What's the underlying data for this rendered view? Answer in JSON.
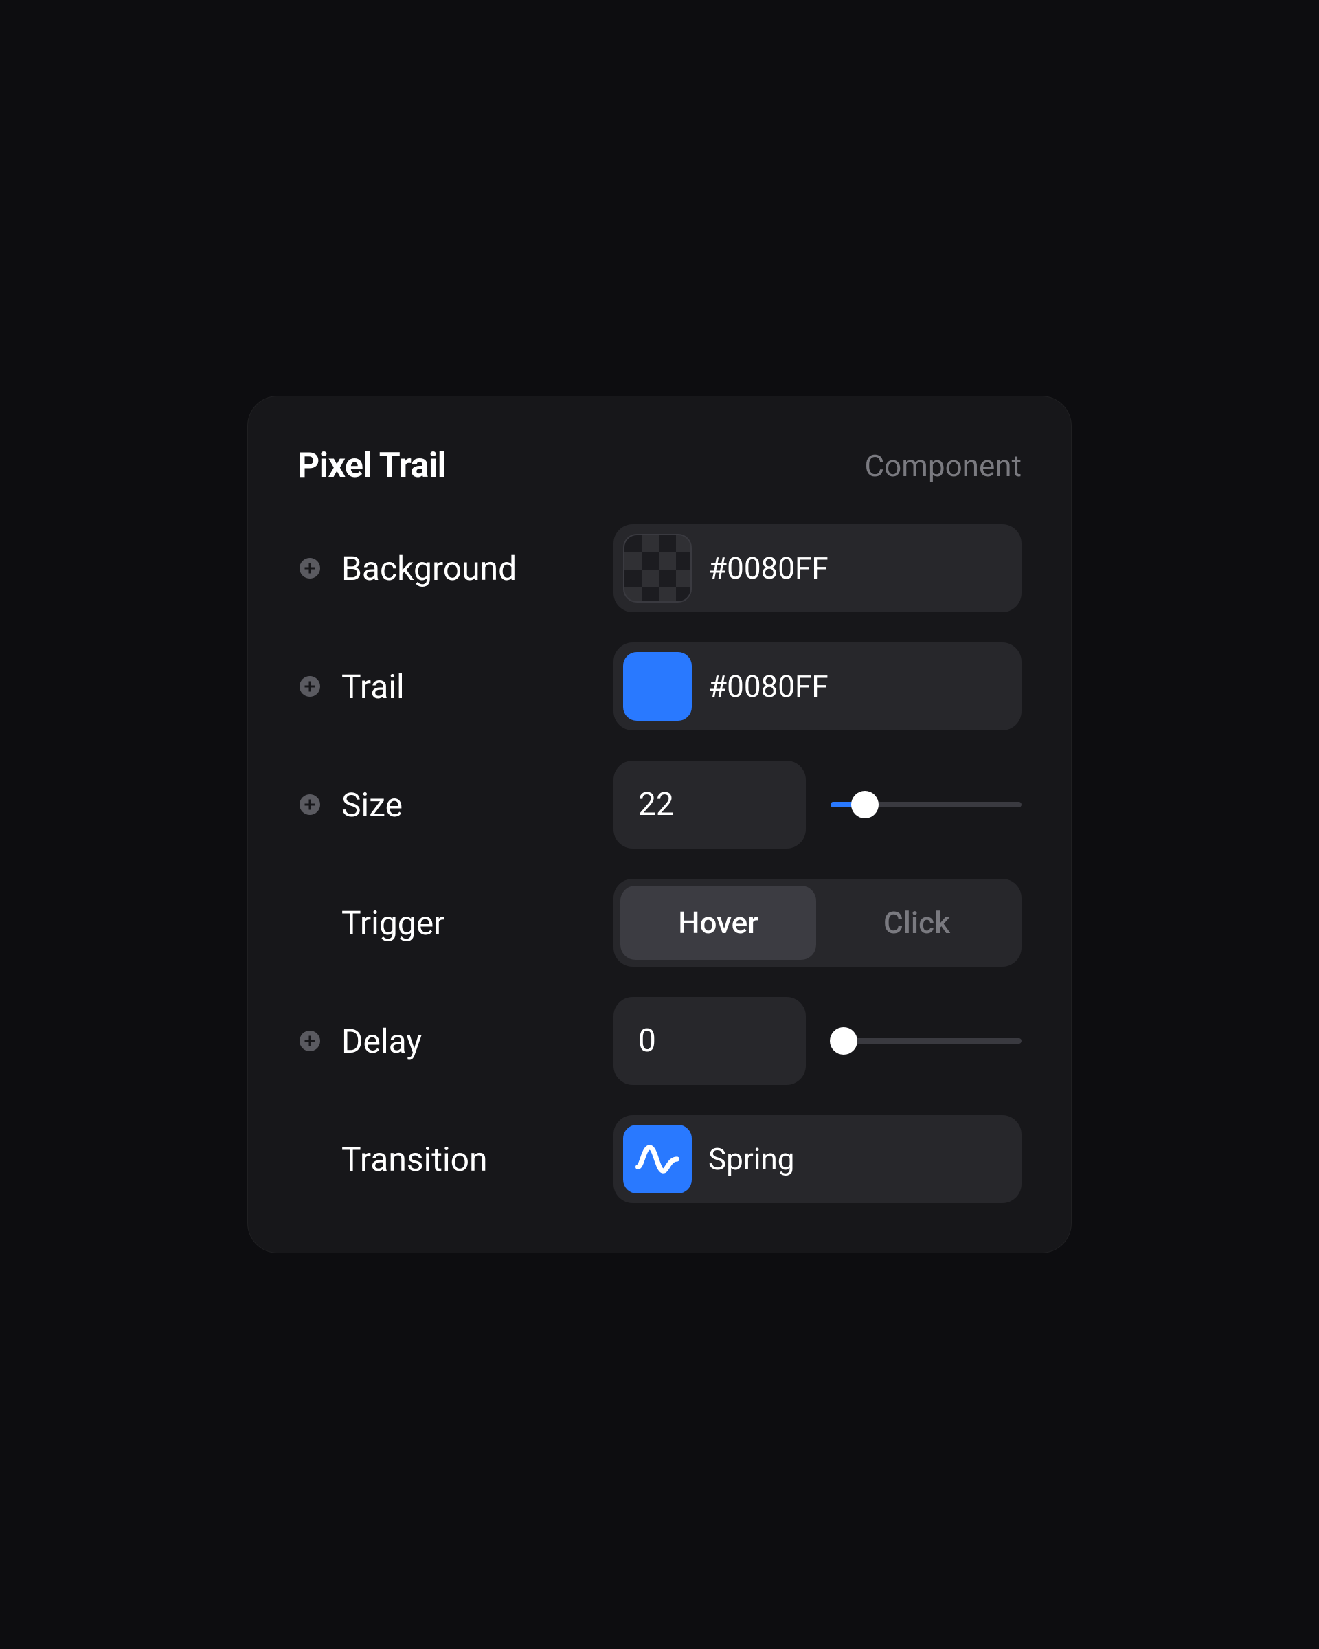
{
  "header": {
    "title": "Pixel Trail",
    "subtitle": "Component"
  },
  "rows": {
    "background": {
      "label": "Background",
      "value": "#0080FF",
      "swatch_transparent": true
    },
    "trail": {
      "label": "Trail",
      "value": "#0080FF",
      "swatch_color": "#2979ff"
    },
    "size": {
      "label": "Size",
      "value": "22",
      "slider_percent": 18
    },
    "trigger": {
      "label": "Trigger",
      "options": [
        "Hover",
        "Click"
      ],
      "active": "Hover"
    },
    "delay": {
      "label": "Delay",
      "value": "0",
      "slider_percent": 0
    },
    "transition": {
      "label": "Transition",
      "value": "Spring"
    }
  }
}
